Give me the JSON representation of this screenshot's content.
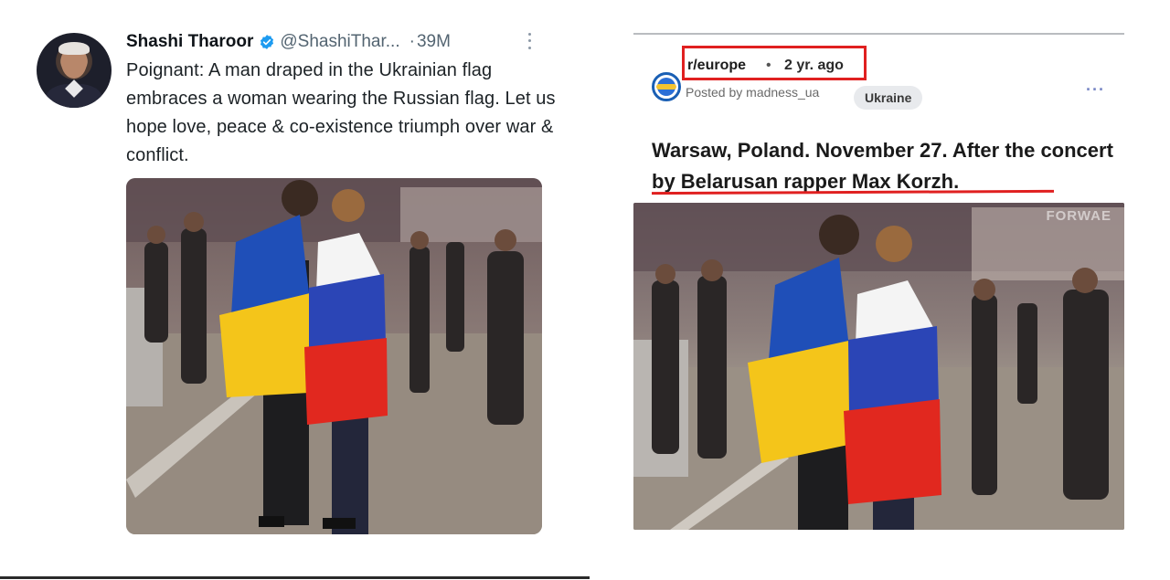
{
  "tweet": {
    "author_name": "Shashi Tharoor",
    "handle": "@ShashiThar...",
    "separator": "·",
    "views": "39M",
    "text": "Poignant: A man draped in the Ukrainian flag embraces a woman wearing the Russian flag. Let us hope love, peace & co-existence triumph over war & conflict.",
    "verified_color": "#1d9bf0"
  },
  "reddit": {
    "subreddit": "r/europe",
    "separator": "•",
    "age": "2 yr. ago",
    "posted_by": "Posted by madness_ua",
    "flair": "Ukraine",
    "more": "···",
    "title": "Warsaw, Poland. November 27. After the concert by Belarusan rapper Max Korzh.",
    "watermark": "FORWAE",
    "highlight_color": "#e02020"
  },
  "icons": [
    "verified-badge-icon",
    "kebab-menu-icon",
    "subreddit-icon",
    "more-options-icon"
  ]
}
